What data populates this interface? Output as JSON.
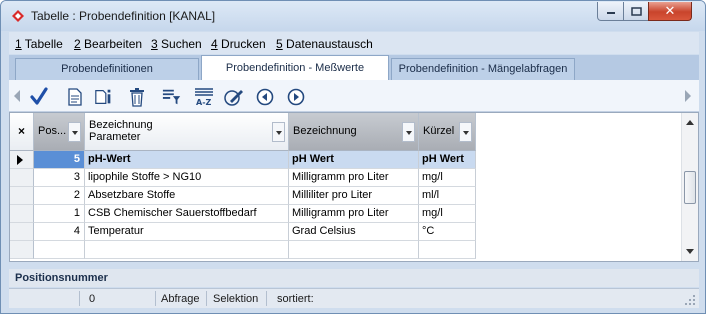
{
  "window": {
    "title": "Tabelle : Probendefinition [KANAL]"
  },
  "menu": [
    {
      "label": "1 Tabelle"
    },
    {
      "label": "2 Bearbeiten"
    },
    {
      "label": "3 Suchen"
    },
    {
      "label": "4 Drucken"
    },
    {
      "label": "5 Datenaustausch"
    }
  ],
  "tabs": [
    {
      "label": "Probendefinitionen",
      "active": false
    },
    {
      "label": "Probendefinition - Meßwerte",
      "active": true
    },
    {
      "label": "Probendefinition - Mängelabfragen",
      "active": false
    }
  ],
  "toolbar": {
    "icons": [
      "nav-left-icon",
      "checkmark-icon",
      "document-icon",
      "document-info-icon",
      "delete-icon",
      "filter-icon",
      "sort-az-icon",
      "edit-icon",
      "previous-icon",
      "next-icon",
      "nav-right-icon"
    ]
  },
  "grid": {
    "columns": [
      {
        "label": "Pos...",
        "key": "pos"
      },
      {
        "label": "Bezeichnung\nParameter",
        "key": "param"
      },
      {
        "label": "Bezeichnung",
        "key": "bez"
      },
      {
        "label": "Kürzel",
        "key": "kurz"
      }
    ],
    "rows": [
      {
        "pos": "5",
        "param": "pH-Wert",
        "bez": "pH Wert",
        "kurz": "pH Wert",
        "current": true
      },
      {
        "pos": "3",
        "param": "lipophile Stoffe > NG10",
        "bez": "Milligramm pro Liter",
        "kurz": "mg/l",
        "current": false
      },
      {
        "pos": "2",
        "param": "Absetzbare Stoffe",
        "bez": "Milliliter pro Liter",
        "kurz": "ml/l",
        "current": false
      },
      {
        "pos": "1",
        "param": "CSB Chemischer Sauerstoffbedarf",
        "bez": "Milligramm pro Liter",
        "kurz": "mg/l",
        "current": false
      },
      {
        "pos": "4",
        "param": "Temperatur",
        "bez": "Grad Celsius",
        "kurz": "°C",
        "current": false
      }
    ]
  },
  "field_label": "Positionsnummer",
  "status": {
    "count": "0",
    "abfrage": "Abfrage",
    "selektion": "Selektion",
    "sortiert": "sortiert:"
  },
  "colors": {
    "accent": "#5a8fd6",
    "current_row": "#c9daf0",
    "close": "#c9442c"
  }
}
